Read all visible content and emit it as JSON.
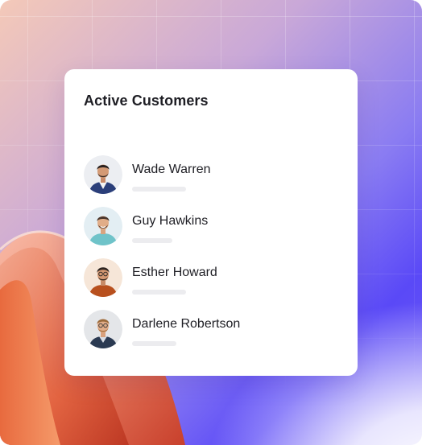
{
  "card": {
    "title": "Active Customers"
  },
  "customers": [
    {
      "name": "Wade Warren",
      "avatar": "avatar-photo-icon"
    },
    {
      "name": "Guy Hawkins",
      "avatar": "avatar-photo-icon"
    },
    {
      "name": "Esther Howard",
      "avatar": "avatar-photo-icon"
    },
    {
      "name": "Darlene Robertson",
      "avatar": "avatar-photo-icon"
    }
  ],
  "colors": {
    "background_purple": "#5a49f7",
    "background_peach": "#f4c9b8",
    "shape_orange": "#e8623a",
    "card": "#ffffff",
    "text": "#1e1e24",
    "placeholder_bar": "#ececef"
  }
}
